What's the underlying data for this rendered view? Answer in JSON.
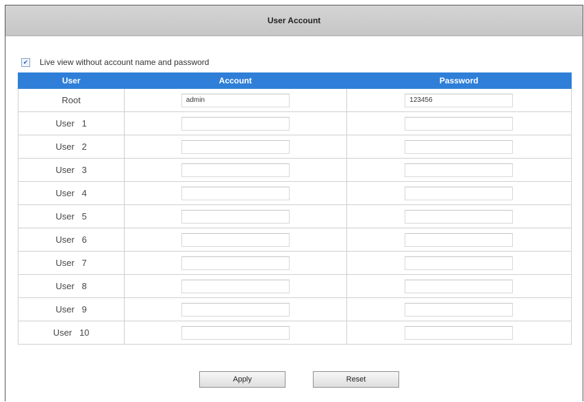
{
  "header": {
    "title": "User Account"
  },
  "live_view": {
    "checked": true,
    "label": "Live view without account name and password"
  },
  "table": {
    "columns": [
      "User",
      "Account",
      "Password"
    ],
    "rows": [
      {
        "user": "Root",
        "account": "admin",
        "password": "123456"
      },
      {
        "user": "User   1",
        "account": "",
        "password": ""
      },
      {
        "user": "User   2",
        "account": "",
        "password": ""
      },
      {
        "user": "User   3",
        "account": "",
        "password": ""
      },
      {
        "user": "User   4",
        "account": "",
        "password": ""
      },
      {
        "user": "User   5",
        "account": "",
        "password": ""
      },
      {
        "user": "User   6",
        "account": "",
        "password": ""
      },
      {
        "user": "User   7",
        "account": "",
        "password": ""
      },
      {
        "user": "User   8",
        "account": "",
        "password": ""
      },
      {
        "user": "User   9",
        "account": "",
        "password": ""
      },
      {
        "user": "User   10",
        "account": "",
        "password": ""
      }
    ]
  },
  "buttons": {
    "apply": "Apply",
    "reset": "Reset"
  },
  "colors": {
    "header_blue": "#2f7fd8",
    "title_bar_gray": "#cbcbcb"
  }
}
